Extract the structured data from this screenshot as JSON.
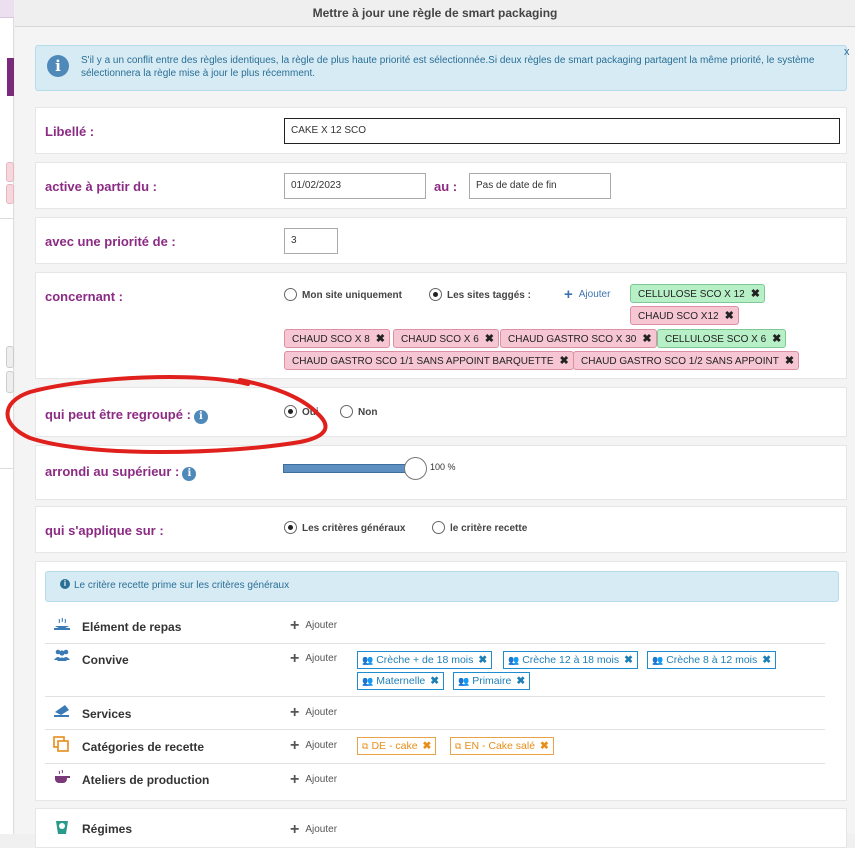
{
  "modal": {
    "title": "Mettre à jour une règle de smart packaging",
    "info_banner": "S'il y a un conflit entre des règles identiques, la règle de plus haute priorité est sélectionnée.Si deux règles de smart packaging partagent la même priorité, le système sélectionnera la règle mise à jour le plus récemment.",
    "close_label": "x"
  },
  "form": {
    "libelle": {
      "label": "Libellé :",
      "value": "CAKE X 12 SCO"
    },
    "active": {
      "label": "active à partir du :",
      "from": "01/02/2023",
      "to_label": "au :",
      "to_placeholder": "Pas de date de fin"
    },
    "priority": {
      "label": "avec une priorité de :",
      "value": "3"
    },
    "concernant": {
      "label": "concernant :",
      "option_mon_site": "Mon site uniquement",
      "option_sites_tagges": "Les sites taggés :",
      "add_label": "Ajouter",
      "selected": "sites_tagges",
      "tags": [
        {
          "text": "CELLULOSE SCO X 12",
          "color": "green"
        },
        {
          "text": "CHAUD SCO X12",
          "color": "pink"
        },
        {
          "text": "CHAUD SCO X 8",
          "color": "pink"
        },
        {
          "text": "CHAUD SCO X 6",
          "color": "pink"
        },
        {
          "text": "CHAUD GASTRO SCO X 30",
          "color": "pink"
        },
        {
          "text": "CELLULOSE SCO X 6",
          "color": "green"
        },
        {
          "text": "CHAUD GASTRO SCO 1/1 SANS APPOINT BARQUETTE",
          "color": "pink"
        },
        {
          "text": "CHAUD GASTRO SCO 1/2 SANS APPOINT",
          "color": "pink"
        }
      ]
    },
    "regroupe": {
      "label": "qui peut être regroupé :",
      "option_oui": "Oui",
      "option_non": "Non",
      "selected": "oui"
    },
    "arrondi": {
      "label": "arrondi au supérieur :",
      "value_text": "100 %",
      "value": 100
    },
    "applique": {
      "label": "qui s'applique sur :",
      "option_generaux": "Les critères généraux",
      "option_recette": "le critère recette",
      "selected": "generaux"
    },
    "recipe_note": "Le critère recette prime sur les critères généraux",
    "criteria": [
      {
        "label": "Elément de repas",
        "icon": "dish-icon",
        "add_label": "Ajouter",
        "tags": []
      },
      {
        "label": "Convive",
        "icon": "people-icon",
        "add_label": "Ajouter",
        "tags": [
          "Crèche + de 18 mois",
          "Crèche 12 à 18 mois",
          "Crèche 8 à 12 mois",
          "Maternelle",
          "Primaire"
        ]
      },
      {
        "label": "Services",
        "icon": "service-icon",
        "add_label": "Ajouter",
        "tags": []
      },
      {
        "label": "Catégories de recette",
        "icon": "copy-icon",
        "add_label": "Ajouter",
        "tags": [
          "DE - cake",
          "EN - Cake salé"
        ]
      },
      {
        "label": "Ateliers de production",
        "icon": "atelier-icon",
        "add_label": "Ajouter",
        "tags": []
      },
      {
        "label": "Régimes",
        "icon": "regime-icon",
        "add_label": "Ajouter",
        "tags": []
      }
    ]
  },
  "colors": {
    "label_purple": "#8b2b84",
    "info_blue": "#4f89b9",
    "annotation_red": "#e0201c"
  }
}
